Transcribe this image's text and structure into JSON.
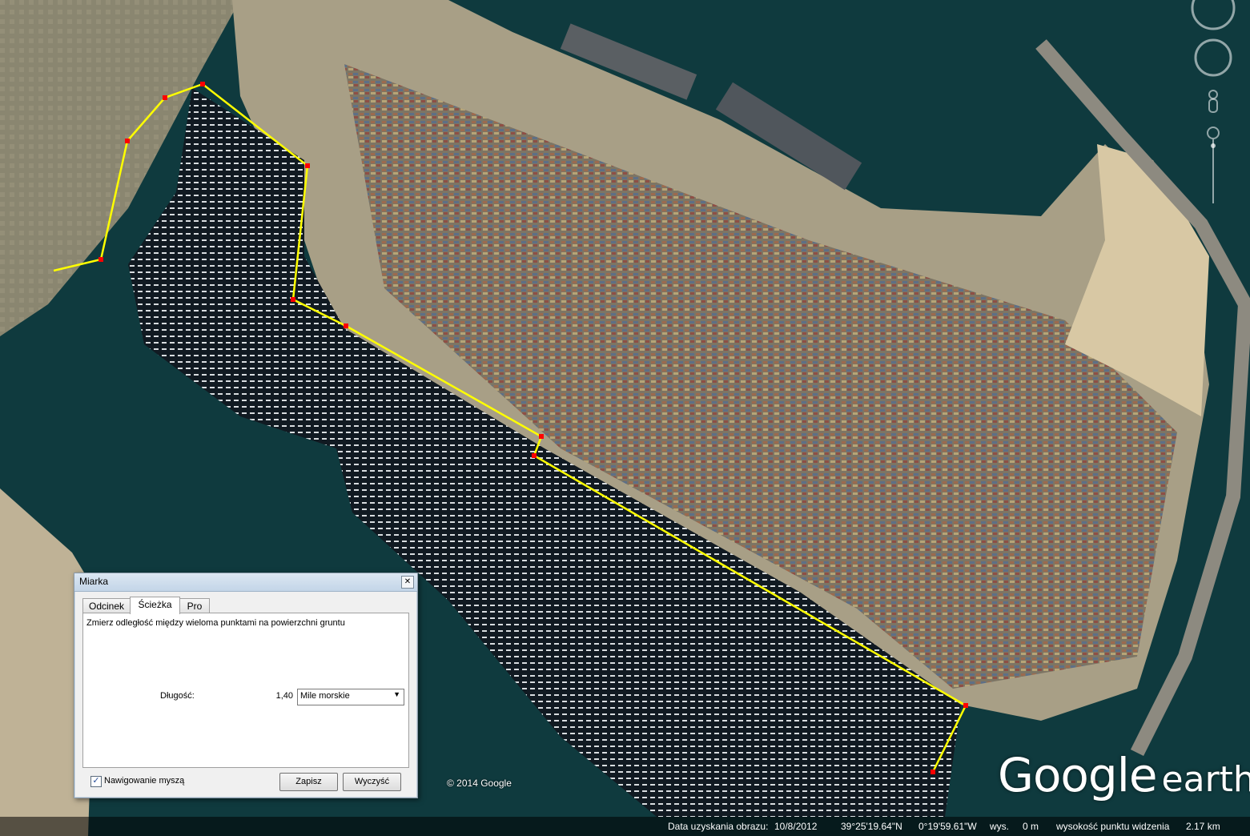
{
  "measure_dialog": {
    "title": "Miarka",
    "close_icon": "close-icon",
    "tabs": [
      "Odcinek",
      "Ścieżka",
      "Pro"
    ],
    "active_tab": "Ścieżka",
    "description": "Zmierz odległość między wieloma punktami na powierzchni gruntu",
    "length_label": "Długość:",
    "length_value": "1,40",
    "unit_selected": "Mile morskie",
    "mouse_nav_label": "Nawigowanie myszą",
    "mouse_nav_checked": true,
    "save_label": "Zapisz",
    "clear_label": "Wyczyść"
  },
  "map": {
    "copyright": "© 2014 Google",
    "logo_google": "Google",
    "logo_earth": "earth",
    "path_color": "#ffff00",
    "vertex_color": "#ff0000"
  },
  "status_bar": {
    "image_date_label": "Data uzyskania obrazu:",
    "image_date": "10/8/2012",
    "latitude": "39°25'19.64\"N",
    "longitude": "0°19'59.61\"W",
    "elevation_label": "wys.",
    "elevation": "0 m",
    "eye_alt_label": "wysokość punktu widzenia",
    "eye_alt": "2.17 km"
  }
}
